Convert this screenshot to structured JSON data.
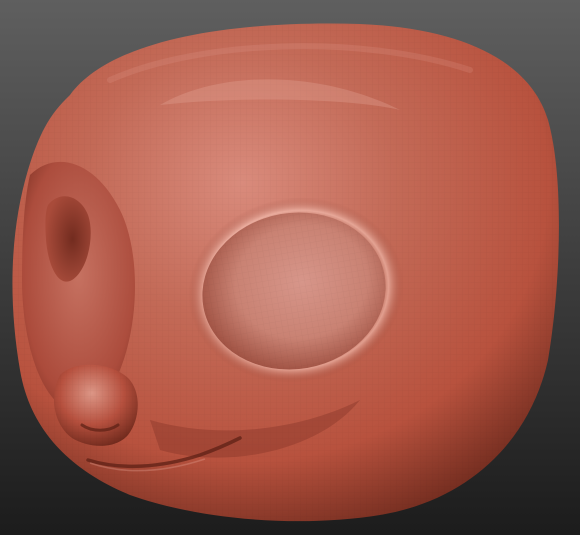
{
  "scene": {
    "subject": "sculpted-head",
    "background_top": "#5f5f5f",
    "background_bottom": "#1c1c1c",
    "material_base": "#b8523e",
    "material_highlight": "#d98b7c",
    "material_shadow": "#5a1f14",
    "eye_socket_color": "#c98273",
    "nose_color": "#b6503e"
  }
}
